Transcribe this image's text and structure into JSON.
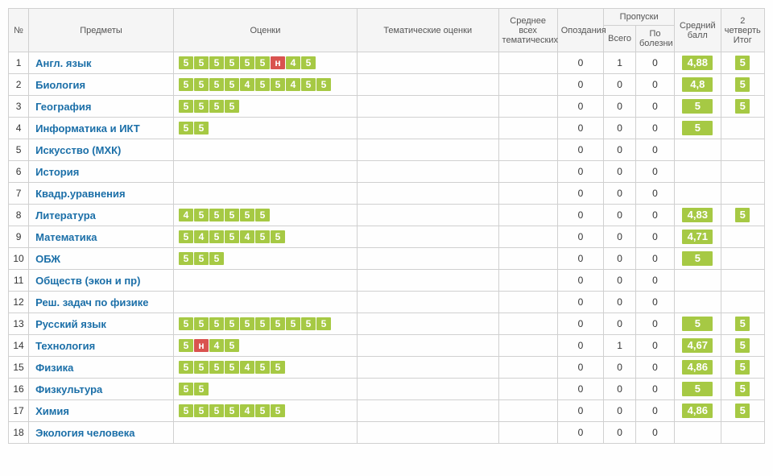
{
  "headers": {
    "num": "№",
    "subject": "Предметы",
    "grades": "Оценки",
    "thematic": "Тематические оценки",
    "avg_thematic": "Среднее всех тематических",
    "lateness": "Опоздания",
    "absences": "Пропуски",
    "abs_total": "Всего",
    "abs_sick": "По болезни",
    "mean": "Средний балл",
    "quarter": "2 четверть Итог"
  },
  "rows": [
    {
      "n": "1",
      "subject": "Англ. язык",
      "grades": [
        [
          "5",
          "g"
        ],
        [
          "5",
          "g"
        ],
        [
          "5",
          "g"
        ],
        [
          "5",
          "g"
        ],
        [
          "5",
          "g"
        ],
        [
          "5",
          "g"
        ],
        [
          "н",
          "r"
        ],
        [
          "4",
          "g"
        ],
        [
          "5",
          "g"
        ]
      ],
      "late": "0",
      "abs": "1",
      "sick": "0",
      "mean": "4,88",
      "final": "5"
    },
    {
      "n": "2",
      "subject": "Биология",
      "grades": [
        [
          "5",
          "g"
        ],
        [
          "5",
          "g"
        ],
        [
          "5",
          "g"
        ],
        [
          "5",
          "g"
        ],
        [
          "4",
          "g"
        ],
        [
          "5",
          "g"
        ],
        [
          "5",
          "g"
        ],
        [
          "4",
          "g"
        ],
        [
          "5",
          "g"
        ],
        [
          "5",
          "g"
        ]
      ],
      "late": "0",
      "abs": "0",
      "sick": "0",
      "mean": "4,8",
      "final": "5"
    },
    {
      "n": "3",
      "subject": "География",
      "grades": [
        [
          "5",
          "g"
        ],
        [
          "5",
          "g"
        ],
        [
          "5",
          "g"
        ],
        [
          "5",
          "g"
        ]
      ],
      "late": "0",
      "abs": "0",
      "sick": "0",
      "mean": "5",
      "final": "5"
    },
    {
      "n": "4",
      "subject": "Информатика и ИКТ",
      "grades": [
        [
          "5",
          "g"
        ],
        [
          "5",
          "g"
        ]
      ],
      "late": "0",
      "abs": "0",
      "sick": "0",
      "mean": "5",
      "final": ""
    },
    {
      "n": "5",
      "subject": "Искусство (МХК)",
      "grades": [],
      "late": "0",
      "abs": "0",
      "sick": "0",
      "mean": "",
      "final": ""
    },
    {
      "n": "6",
      "subject": "История",
      "grades": [],
      "late": "0",
      "abs": "0",
      "sick": "0",
      "mean": "",
      "final": ""
    },
    {
      "n": "7",
      "subject": "Квадр.уравнения",
      "grades": [],
      "late": "0",
      "abs": "0",
      "sick": "0",
      "mean": "",
      "final": ""
    },
    {
      "n": "8",
      "subject": "Литература",
      "grades": [
        [
          "4",
          "g"
        ],
        [
          "5",
          "g"
        ],
        [
          "5",
          "g"
        ],
        [
          "5",
          "g"
        ],
        [
          "5",
          "g"
        ],
        [
          "5",
          "g"
        ]
      ],
      "late": "0",
      "abs": "0",
      "sick": "0",
      "mean": "4,83",
      "final": "5"
    },
    {
      "n": "9",
      "subject": "Математика",
      "grades": [
        [
          "5",
          "g"
        ],
        [
          "4",
          "g"
        ],
        [
          "5",
          "g"
        ],
        [
          "5",
          "g"
        ],
        [
          "4",
          "g"
        ],
        [
          "5",
          "g"
        ],
        [
          "5",
          "g"
        ]
      ],
      "late": "0",
      "abs": "0",
      "sick": "0",
      "mean": "4,71",
      "final": ""
    },
    {
      "n": "10",
      "subject": "ОБЖ",
      "grades": [
        [
          "5",
          "g"
        ],
        [
          "5",
          "g"
        ],
        [
          "5",
          "g"
        ]
      ],
      "late": "0",
      "abs": "0",
      "sick": "0",
      "mean": "5",
      "final": ""
    },
    {
      "n": "11",
      "subject": "Обществ (экон и пр)",
      "grades": [],
      "late": "0",
      "abs": "0",
      "sick": "0",
      "mean": "",
      "final": ""
    },
    {
      "n": "12",
      "subject": "Реш. задач по физике",
      "grades": [],
      "late": "0",
      "abs": "0",
      "sick": "0",
      "mean": "",
      "final": ""
    },
    {
      "n": "13",
      "subject": "Русский язык",
      "grades": [
        [
          "5",
          "g"
        ],
        [
          "5",
          "g"
        ],
        [
          "5",
          "g"
        ],
        [
          "5",
          "g"
        ],
        [
          "5",
          "g"
        ],
        [
          "5",
          "g"
        ],
        [
          "5",
          "g"
        ],
        [
          "5",
          "g"
        ],
        [
          "5",
          "g"
        ],
        [
          "5",
          "g"
        ]
      ],
      "late": "0",
      "abs": "0",
      "sick": "0",
      "mean": "5",
      "final": "5"
    },
    {
      "n": "14",
      "subject": "Технология",
      "grades": [
        [
          "5",
          "g"
        ],
        [
          "н",
          "r"
        ],
        [
          "4",
          "g"
        ],
        [
          "5",
          "g"
        ]
      ],
      "late": "0",
      "abs": "1",
      "sick": "0",
      "mean": "4,67",
      "final": "5"
    },
    {
      "n": "15",
      "subject": "Физика",
      "grades": [
        [
          "5",
          "g"
        ],
        [
          "5",
          "g"
        ],
        [
          "5",
          "g"
        ],
        [
          "5",
          "g"
        ],
        [
          "4",
          "g"
        ],
        [
          "5",
          "g"
        ],
        [
          "5",
          "g"
        ]
      ],
      "late": "0",
      "abs": "0",
      "sick": "0",
      "mean": "4,86",
      "final": "5"
    },
    {
      "n": "16",
      "subject": "Физкультура",
      "grades": [
        [
          "5",
          "g"
        ],
        [
          "5",
          "g"
        ]
      ],
      "late": "0",
      "abs": "0",
      "sick": "0",
      "mean": "5",
      "final": "5"
    },
    {
      "n": "17",
      "subject": "Химия",
      "grades": [
        [
          "5",
          "g"
        ],
        [
          "5",
          "g"
        ],
        [
          "5",
          "g"
        ],
        [
          "5",
          "g"
        ],
        [
          "4",
          "g"
        ],
        [
          "5",
          "g"
        ],
        [
          "5",
          "g"
        ]
      ],
      "late": "0",
      "abs": "0",
      "sick": "0",
      "mean": "4,86",
      "final": "5"
    },
    {
      "n": "18",
      "subject": "Экология человека",
      "grades": [],
      "late": "0",
      "abs": "0",
      "sick": "0",
      "mean": "",
      "final": ""
    }
  ]
}
